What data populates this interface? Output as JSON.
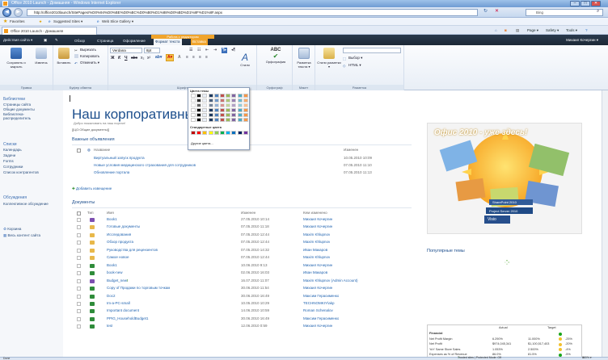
{
  "browser": {
    "window_title": "Office 2010 Launch - Домашняя - Windows Internet Explorer",
    "url": "http://office2010launch/SitePages/%D0%94%D0%BE%D0%BC%D0%B0%D1%88%D0%BD%D1%8F%D1%8F.aspx",
    "search_placeholder": "Bing",
    "favorites_label": "Favorites",
    "fav_items": [
      "Suggested Sites ▾",
      "Web Slice Gallery ▾"
    ],
    "tab_title": "Office 2010 Launch - Домашняя",
    "command_items": [
      "Page ▾",
      "Safety ▾",
      "Tools ▾"
    ],
    "window_buttons": [
      "–",
      "□",
      "✕"
    ]
  },
  "ribbon": {
    "site_actions": "Действия сайта ▾",
    "tabs": [
      "Обзор",
      "Страница",
      "Оформление",
      "Формат текста",
      "Вставка"
    ],
    "context_header": "Работа с редактором",
    "user": "Михаил Кочергин ▾",
    "save_label": "Сохранить и закрыть",
    "checkout_label": "Извлечь",
    "paste_label": "Вставить",
    "cut_label": "Вырезать",
    "copy_label": "Копировать",
    "undo_label": "Отменить ▾",
    "font_name": "Verdana",
    "font_size": "8pt",
    "styles_label": "Стили",
    "spelling_label": "Орфография",
    "markup_label": "Разметка текста ▾",
    "markup_styles_label": "Стили разметки ▾",
    "select_label": "Выбор ▾",
    "html_label": "HTML ▾",
    "groups": [
      "Правка",
      "Буфер обмена",
      "Шрифт",
      "Стили",
      "Орфограф",
      "Макет",
      "Разметка"
    ]
  },
  "color_picker": {
    "theme_header": "Цвета темы",
    "standard_header": "Стандартные цвета",
    "more_label": "Другие цвета...",
    "theme_colors": [
      "#ffffff",
      "#000000",
      "#e8eef7",
      "#1f3a5f",
      "#4f81bd",
      "#c0504d",
      "#9bbb59",
      "#8064a2",
      "#4bacc6",
      "#f79646"
    ],
    "standard_colors": [
      "#c00000",
      "#ff0000",
      "#ffc000",
      "#ffff00",
      "#92d050",
      "#00b050",
      "#00b0f0",
      "#0070c0",
      "#002060",
      "#7030a0"
    ]
  },
  "quicklaunch": {
    "sections": [
      {
        "title": "Библиотеки",
        "items": [
          "Страницы сайта",
          "Общие документы",
          "Библиотека-распределитель"
        ]
      },
      {
        "title": "Списки",
        "items": [
          "Календарь",
          "Задачи",
          "Forms",
          "Сотрудники",
          "Список контрагентов"
        ]
      },
      {
        "title": "Обсуждения",
        "items": [
          "Коллективное обсуждение"
        ]
      }
    ],
    "recycle": "Корзина",
    "all_content": "Весь контент сайта"
  },
  "page": {
    "title": "Наш корпоративный",
    "welcome": "Добро пожаловать на наш портал!",
    "placeholder": "[[ЦО:Общие документы]]"
  },
  "announcements": {
    "title": "Важные объявления",
    "col_name": "Название",
    "col_modified": "Изменен",
    "rows": [
      {
        "name": "Виртуальный запуск продукта",
        "date": "10.05.2010 10:09"
      },
      {
        "name": "Новые условия медицинского страхования для сотрудников",
        "date": "07.05.2010 11:10"
      },
      {
        "name": "Обновление портала",
        "date": "07.05.2010 11:13"
      }
    ],
    "add_link": "Добавить извещение"
  },
  "documents": {
    "title": "Документы",
    "col_type": "Тип",
    "col_name": "Имя",
    "col_modified": "Изменен",
    "col_author": "Кем изменено",
    "rows": [
      {
        "type": "doc-purple",
        "name": "Book1",
        "date": "27.05.2010 10:14",
        "author": "Михаил Кочергин"
      },
      {
        "type": "folder",
        "name": "Готовые документы",
        "date": "07.05.2010 11:18",
        "author": "Михаил Кочергин"
      },
      {
        "type": "folder",
        "name": "Исследования",
        "date": "07.05.2010 12:44",
        "author": "Maxim Khlupnov"
      },
      {
        "type": "folder",
        "name": "Обзор продукта",
        "date": "07.05.2010 12:44",
        "author": "Maxim Khlupnov"
      },
      {
        "type": "folder",
        "name": "Руководства для рецензентов",
        "date": "07.05.2010 14:32",
        "author": "Иван Макаров"
      },
      {
        "type": "folder",
        "name": "Самое новое",
        "date": "07.05.2010 12:44",
        "author": "Maxim Khlupnov"
      },
      {
        "type": "excel",
        "name": "Book1",
        "date": "10.06.2010 9:13",
        "author": "Михаил Кочергин"
      },
      {
        "type": "excel",
        "name": "book-new",
        "date": "02.06.2010 16:03",
        "author": "Иван Макаров"
      },
      {
        "type": "doc-purple",
        "name": "Budget_new",
        "date": "16.07.2010 11:07",
        "author": "Maxim Khlupnov (Admin Account)"
      },
      {
        "type": "excel",
        "name": "Copy of Продажи по торговым точкам",
        "date": "30.06.2010 11:54",
        "author": "Михаил Кочергин"
      },
      {
        "type": "excel",
        "name": "Doc2",
        "date": "30.06.2010 16:49",
        "author": "Максим Герасименко"
      },
      {
        "type": "excel",
        "name": "Im-a-PC-small",
        "date": "10.05.2010 10:29",
        "author": "TECHNOMKIY\\akp"
      },
      {
        "type": "excel",
        "name": "Important document",
        "date": "14.06.2010 10:59",
        "author": "Roman Schenalov"
      },
      {
        "type": "excel",
        "name": "PPIG_HouseholdBudget1",
        "date": "30.06.2010 16:49",
        "author": "Максим Герасименко"
      },
      {
        "type": "excel",
        "name": "test",
        "date": "12.06.2010 0:59",
        "author": "Михаил Кочергин"
      }
    ],
    "new_badge": "!"
  },
  "promo": {
    "headline": "Офис 2010 - уже здесь!",
    "badge1": "SharePoint 2010",
    "badge2": "Project Server 2010",
    "badge3": "Visio"
  },
  "popular": {
    "title": "Популярные темы"
  },
  "dashboard": {
    "col_actual": "Actual",
    "col_target": "Target",
    "rows": [
      {
        "label": "Financial",
        "actual": "",
        "target": "",
        "status": "#1aa51a"
      },
      {
        "label": "Net Profit Margin",
        "actual": "6.290%",
        "target": "11.000%",
        "status": "#f2c12e",
        "pct": "-25%"
      },
      {
        "label": "Net Profit",
        "actual": "$974,045,341",
        "target": "$1,100,517,403",
        "status": "#f2c12e",
        "pct": "-20%"
      },
      {
        "label": "YoY Same Store Sales",
        "actual": "1.053%",
        "target": "2.500%",
        "status": "#f2c12e",
        "pct": "-4%"
      },
      {
        "label": "Expenses as % of Revenue",
        "actual": "86.0%",
        "target": "81.5%",
        "status": "#1aa51a",
        "pct": "-5%"
      }
    ]
  },
  "statusbar": {
    "left": "Done",
    "zone": "Trusted sites | Protected Mode: Off",
    "zoom": "100% ▾"
  }
}
